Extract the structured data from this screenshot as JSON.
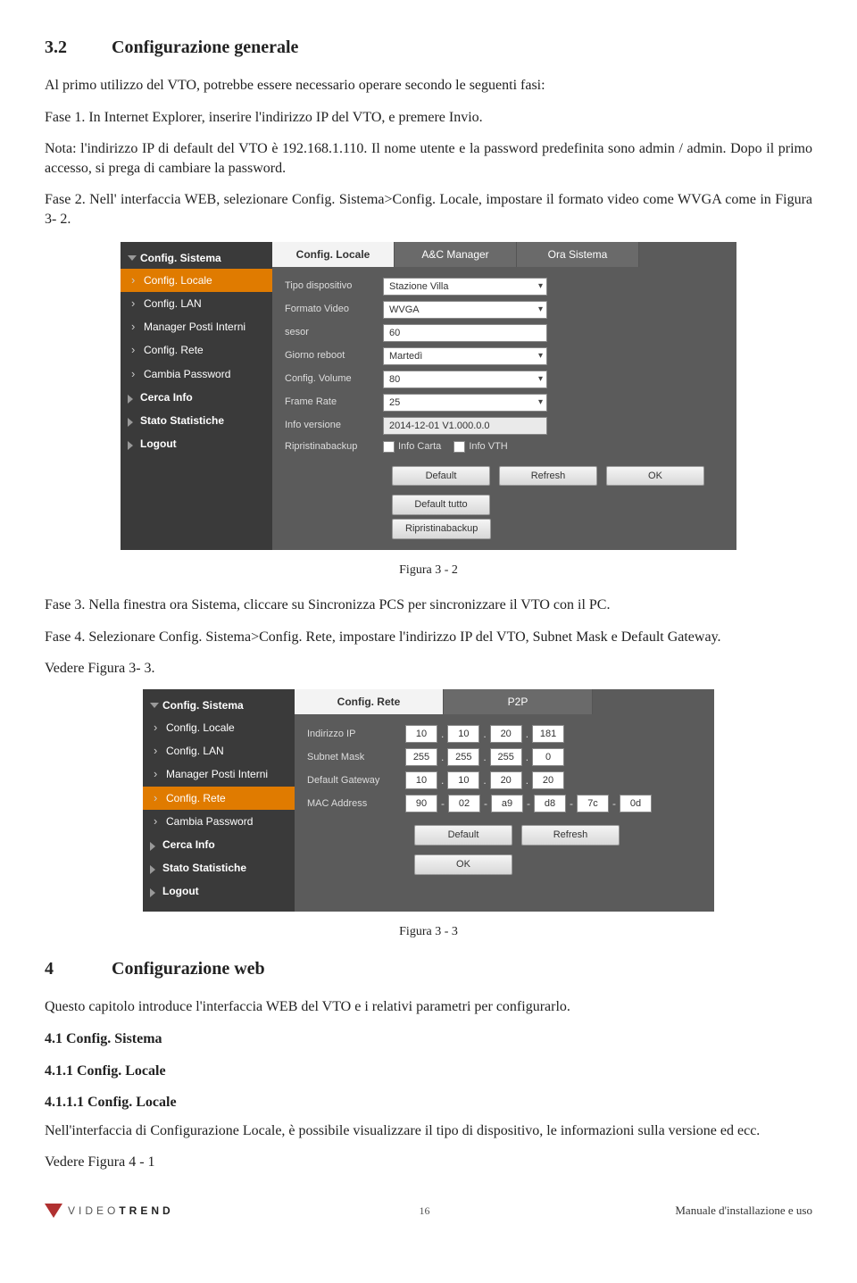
{
  "doc": {
    "sec32_num": "3.2",
    "sec32_title": "Configurazione generale",
    "para1": "Al primo utilizzo del VTO, potrebbe essere necessario operare secondo le seguenti fasi:",
    "para2": "Fase 1. In Internet Explorer, inserire l'indirizzo IP del VTO, e premere Invio.",
    "para3": "Nota: l'indirizzo IP di default del VTO è 192.168.1.110. Il nome utente e la password predefinita sono admin / admin. Dopo il primo accesso, si prega di cambiare la password.",
    "para4": "Fase 2. Nell' interfaccia WEB, selezionare Config. Sistema>Config. Locale, impostare il formato video come WVGA come in Figura 3- 2.",
    "fig32": "Figura 3 - 2",
    "para5": "Fase 3. Nella finestra ora Sistema, cliccare su Sincronizza PCS per sincronizzare il VTO con il PC.",
    "para6": "Fase 4. Selezionare Config. Sistema>Config. Rete, impostare l'indirizzo IP del VTO, Subnet Mask e  Default Gateway.",
    "para7": "Vedere Figura 3- 3.",
    "fig33": "Figura 3 - 3",
    "sec4_num": "4",
    "sec4_title": "Configurazione web",
    "para8": "Questo capitolo introduce l'interfaccia WEB del VTO e i relativi parametri  per configurarlo.",
    "sec41": "4.1 Config. Sistema",
    "sec411": "4.1.1 Config. Locale",
    "sec4111": "4.1.1.1 Config. Locale",
    "para9": "Nell'interfaccia di Configurazione Locale, è possibile visualizzare il tipo di dispositivo, le informazioni sulla versione ed ecc.",
    "para10": "Vedere Figura 4 - 1",
    "page": "16",
    "manual": "Manuale d'installazione e uso",
    "logo1": "VIDEO",
    "logo2": "TREND"
  },
  "panel1": {
    "side_head": "Config. Sistema",
    "side_items": [
      "Config. Locale",
      "Config. LAN",
      "Manager Posti Interni",
      "Config. Rete",
      "Cambia Password"
    ],
    "side_subs": [
      "Cerca Info",
      "Stato Statistiche",
      "Logout"
    ],
    "tabs": [
      "Config. Locale",
      "A&C Manager",
      "Ora Sistema"
    ],
    "rows": {
      "tipo": {
        "label": "Tipo dispositivo",
        "value": "Stazione Villa"
      },
      "formato": {
        "label": "Formato Video",
        "value": "WVGA"
      },
      "sesor": {
        "label": "sesor",
        "value": "60"
      },
      "giorno": {
        "label": "Giorno reboot",
        "value": "Martedì"
      },
      "volume": {
        "label": "Config. Volume",
        "value": "80"
      },
      "frame": {
        "label": "Frame Rate",
        "value": "25"
      },
      "info": {
        "label": "Info versione",
        "value": "2014-12-01 V1.000.0.0"
      },
      "rip": {
        "label": "Ripristinabackup",
        "c1": "Info Carta",
        "c2": "Info VTH"
      }
    },
    "btns": [
      "Default",
      "Refresh",
      "OK",
      "Default tutto"
    ],
    "btn2": "Ripristinabackup"
  },
  "panel2": {
    "side_head": "Config. Sistema",
    "side_items": [
      "Config. Locale",
      "Config. LAN",
      "Manager Posti Interni",
      "Config. Rete",
      "Cambia Password"
    ],
    "side_subs": [
      "Cerca Info",
      "Stato Statistiche",
      "Logout"
    ],
    "tabs": [
      "Config. Rete",
      "P2P"
    ],
    "rows": {
      "ip": {
        "label": "Indirizzo IP",
        "v": [
          "10",
          "10",
          "20",
          "181"
        ]
      },
      "mask": {
        "label": "Subnet Mask",
        "v": [
          "255",
          "255",
          "255",
          "0"
        ]
      },
      "gw": {
        "label": "Default Gateway",
        "v": [
          "10",
          "10",
          "20",
          "20"
        ]
      },
      "mac": {
        "label": "MAC Address",
        "v": [
          "90",
          "02",
          "a9",
          "d8",
          "7c",
          "0d"
        ]
      }
    },
    "btns": [
      "Default",
      "Refresh",
      "OK"
    ]
  }
}
